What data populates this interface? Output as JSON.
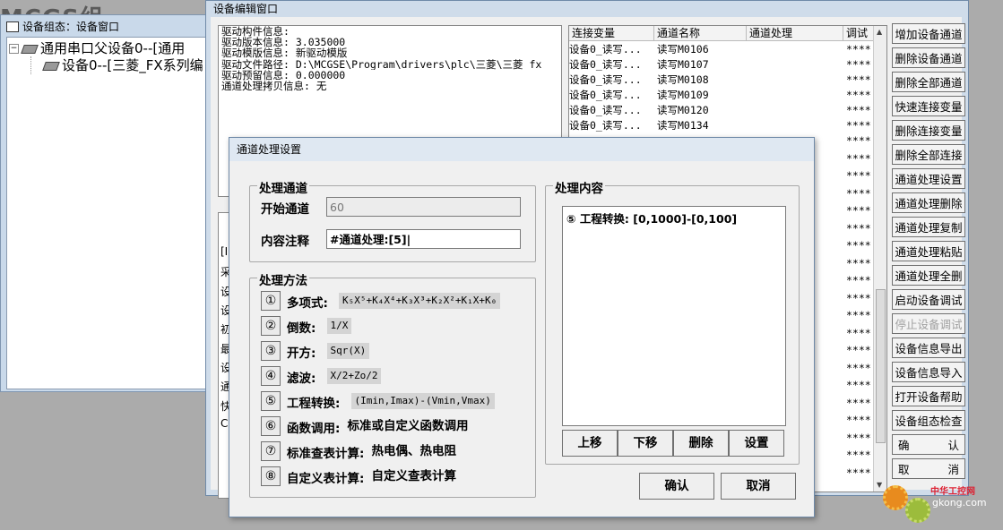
{
  "background_title": "MCGS组",
  "tree_window": {
    "title": "设备组态：设备窗口",
    "nodes": [
      {
        "label": "通用串口父设备0--[通用",
        "expander": "−"
      },
      {
        "label": "设备0--[三菱_FX系列编"
      }
    ]
  },
  "edit_window": {
    "title": "设备编辑窗口",
    "info_lines": [
      "驱动构件信息:",
      "驱动版本信息: 3.035000",
      "驱动模版信息: 新驱动模版",
      "驱动文件路径: D:\\MCGSE\\Program\\drivers\\plc\\三菱\\三菱_fx",
      "驱动预留信息: 0.000000",
      "通道处理拷贝信息: 无"
    ],
    "prop_rows": [
      "[I",
      "采",
      "设",
      "设",
      "初",
      "最",
      "设",
      "通",
      "快",
      "CF"
    ],
    "table": {
      "headers": [
        "连接变量",
        "通道名称",
        "通道处理",
        "调试"
      ],
      "rows": [
        {
          "var": "设备0_读写...",
          "name": "读写M0106",
          "proc": "",
          "debug": "****"
        },
        {
          "var": "设备0_读写...",
          "name": "读写M0107",
          "proc": "",
          "debug": "****"
        },
        {
          "var": "设备0_读写...",
          "name": "读写M0108",
          "proc": "",
          "debug": "****"
        },
        {
          "var": "设备0_读写...",
          "name": "读写M0109",
          "proc": "",
          "debug": "****"
        },
        {
          "var": "设备0_读写...",
          "name": "读写M0120",
          "proc": "",
          "debug": "****"
        },
        {
          "var": "设备0_读写...",
          "name": "读写M0134",
          "proc": "",
          "debug": "****"
        }
      ],
      "hidden_debug": [
        "****",
        "****",
        "****",
        "****",
        "****",
        "****",
        "****",
        "****",
        "****",
        "****",
        "****",
        "****",
        "****",
        "****",
        "****",
        "****",
        "****",
        "****",
        "****",
        "****"
      ]
    },
    "buttons": [
      {
        "label": "增加设备通道",
        "enabled": true
      },
      {
        "label": "删除设备通道",
        "enabled": true
      },
      {
        "label": "删除全部通道",
        "enabled": true
      },
      {
        "label": "快速连接变量",
        "enabled": true
      },
      {
        "label": "删除连接变量",
        "enabled": true
      },
      {
        "label": "删除全部连接",
        "enabled": true
      },
      {
        "label": "通道处理设置",
        "enabled": true
      },
      {
        "label": "通道处理删除",
        "enabled": true
      },
      {
        "label": "通道处理复制",
        "enabled": true
      },
      {
        "label": "通道处理粘贴",
        "enabled": true
      },
      {
        "label": "通道处理全删",
        "enabled": true
      },
      {
        "label": "启动设备调试",
        "enabled": true
      },
      {
        "label": "停止设备调试",
        "enabled": false
      },
      {
        "label": "设备信息导出",
        "enabled": true
      },
      {
        "label": "设备信息导入",
        "enabled": true
      },
      {
        "label": "打开设备帮助",
        "enabled": true
      },
      {
        "label": "设备组态检查",
        "enabled": true
      }
    ],
    "confirm": {
      "left": "确",
      "right": "认"
    },
    "cancel": {
      "left": "取",
      "right": "消"
    }
  },
  "dialog": {
    "title": "通道处理设置",
    "channel_group": {
      "label": "处理通道",
      "start_label": "开始通道",
      "start_value": "60",
      "comment_label": "内容注释",
      "comment_value": "#通道处理:[5]|"
    },
    "method_group": {
      "label": "处理方法",
      "methods": [
        {
          "num": "①",
          "name": "多项式:",
          "formula": "K₅X⁵+K₄X⁴+K₃X³+K₂X²+K₁X+K₀"
        },
        {
          "num": "②",
          "name": "倒数:",
          "formula": "1/X"
        },
        {
          "num": "③",
          "name": "开方:",
          "formula": "Sqr(X)"
        },
        {
          "num": "④",
          "name": "滤波:",
          "formula": "X/2+Zo/2"
        },
        {
          "num": "⑤",
          "name": "工程转换:",
          "formula": "(Imin,Imax)-(Vmin,Vmax)"
        },
        {
          "num": "⑥",
          "name": "函数调用:",
          "formula": "标准或自定义函数调用"
        },
        {
          "num": "⑦",
          "name": "标准查表计算:",
          "formula": "热电偶、热电阻"
        },
        {
          "num": "⑧",
          "name": "自定义表计算:",
          "formula": "自定义查表计算"
        }
      ]
    },
    "content_group": {
      "label": "处理内容",
      "items": [
        "⑤ 工程转换: [0,1000]-[0,100]"
      ],
      "buttons": [
        "上移",
        "下移",
        "删除",
        "设置"
      ]
    },
    "ok_label": "确认",
    "cancel_label": "取消"
  },
  "watermark": {
    "title": "中华工控网",
    "url": "gkong.com"
  }
}
